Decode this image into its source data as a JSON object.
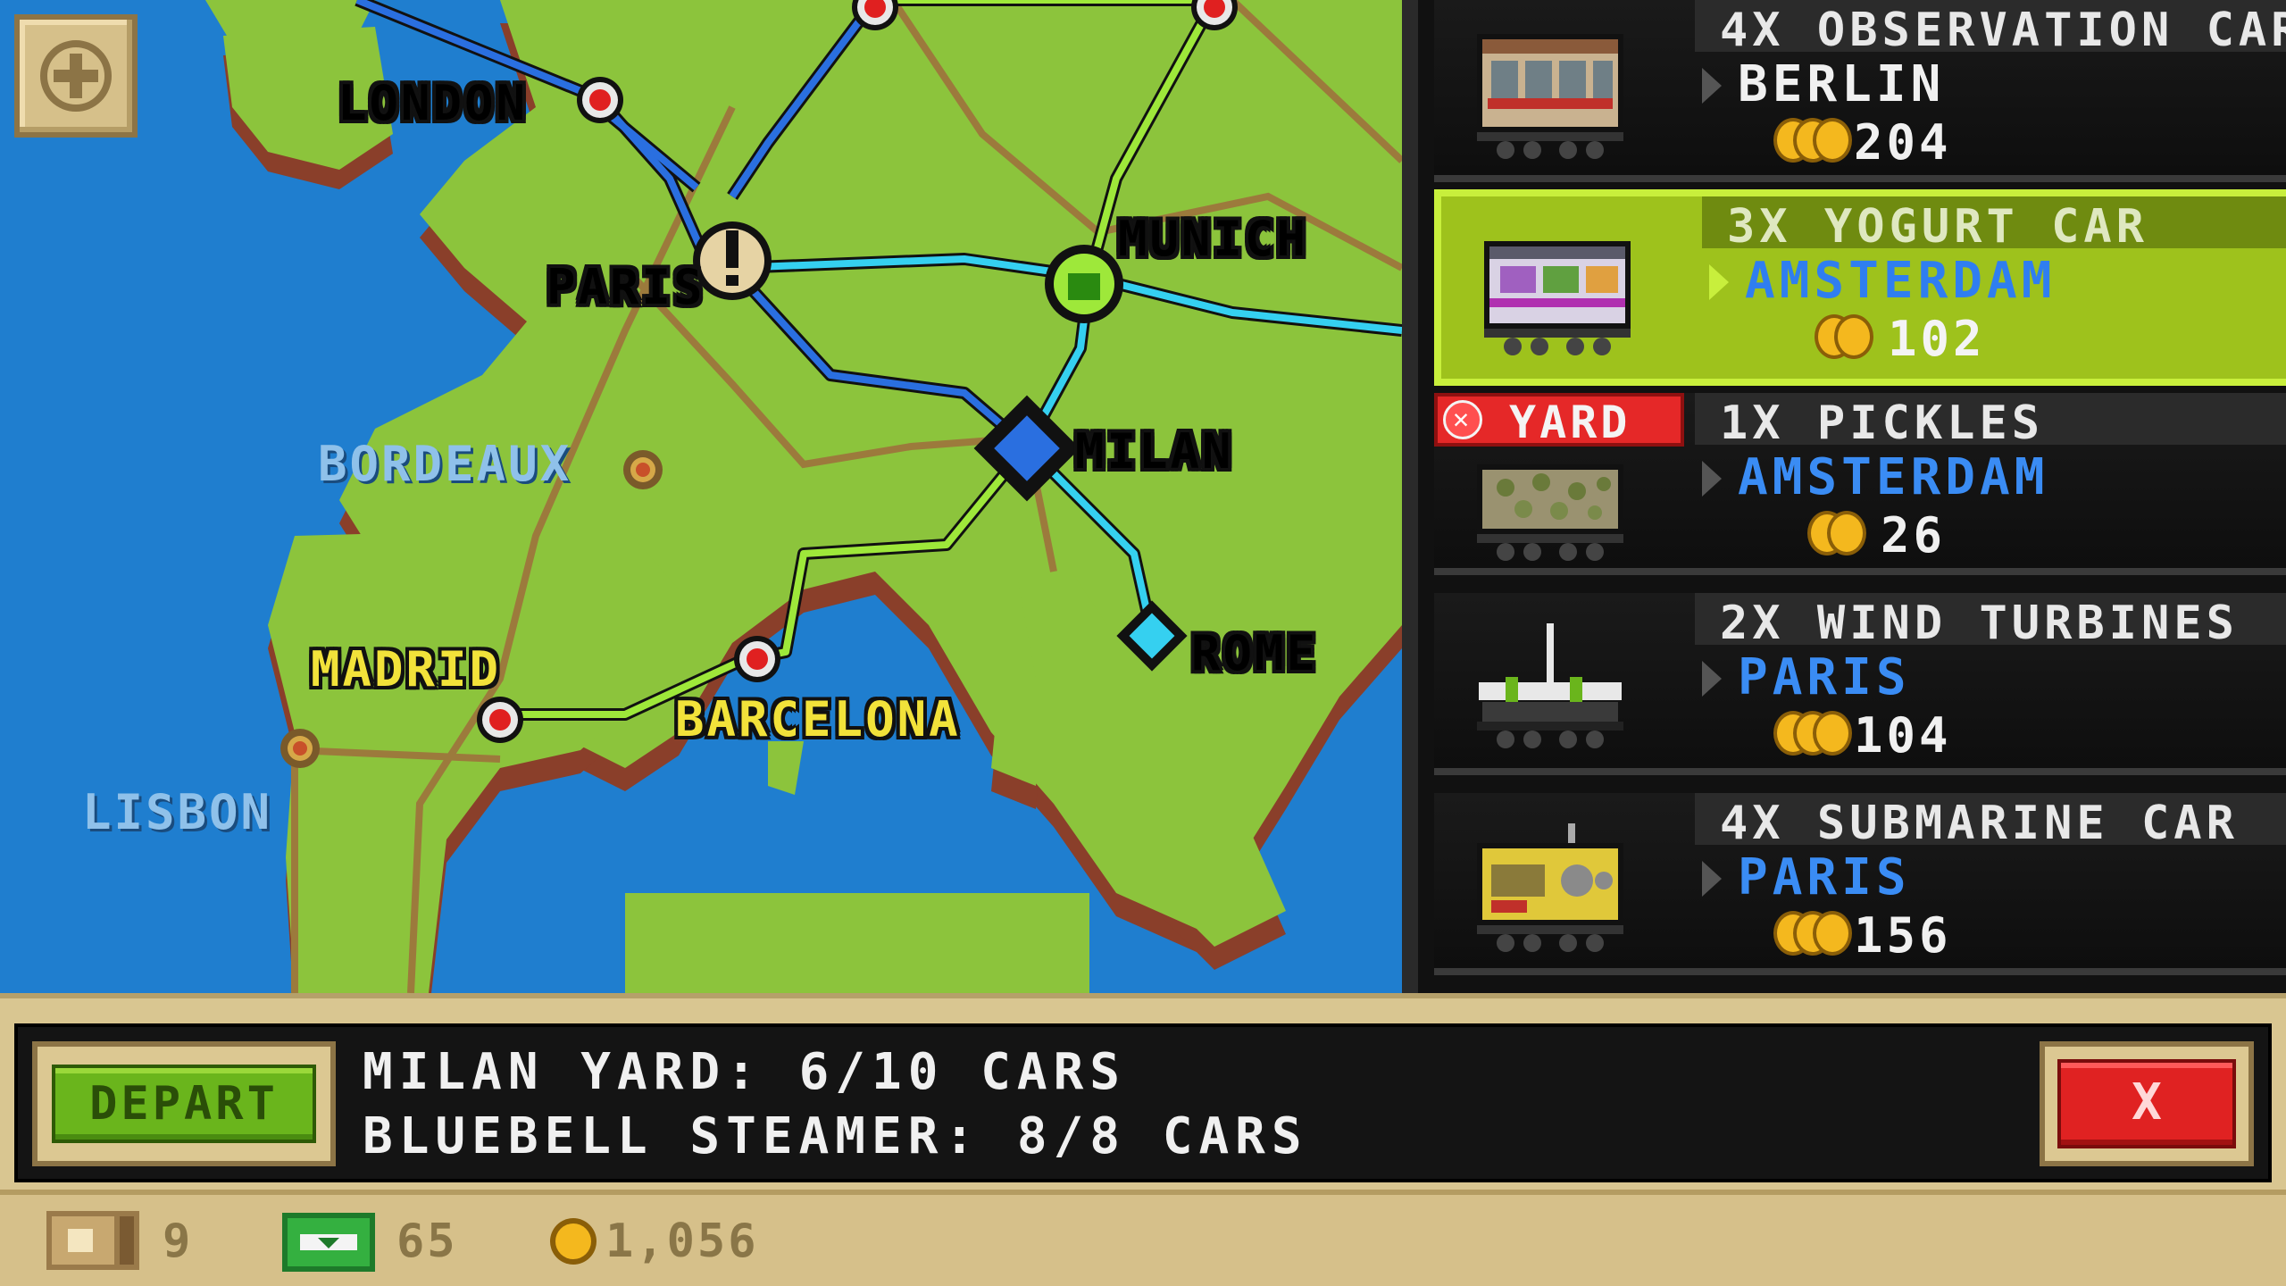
{
  "map": {
    "zoom_icon": "plus-icon",
    "cities": [
      {
        "id": "london",
        "name": "LONDON",
        "color": "#ffffff",
        "dim": false
      },
      {
        "id": "paris",
        "name": "PARIS",
        "color": "#ffffff",
        "dim": false
      },
      {
        "id": "munich",
        "name": "MUNICH",
        "color": "#ffffff",
        "dim": false
      },
      {
        "id": "milan",
        "name": "MILAN",
        "color": "#ffffff",
        "dim": false
      },
      {
        "id": "bordeaux",
        "name": "BORDEAUX",
        "color": "#8fc1ea",
        "dim": true
      },
      {
        "id": "madrid",
        "name": "MADRID",
        "color": "#f2e23a",
        "dim": false
      },
      {
        "id": "barcelona",
        "name": "BARCELONA",
        "color": "#f2e23a",
        "dim": false
      },
      {
        "id": "rome",
        "name": "ROME",
        "color": "#ffffff",
        "dim": false
      },
      {
        "id": "lisbon",
        "name": "LISBON",
        "color": "#8fc1ea",
        "dim": true
      }
    ]
  },
  "cars": [
    {
      "title": "4X OBSERVATION CAR",
      "destination": "BERLIN",
      "dest_color": "#f0f0f0",
      "reward": "204",
      "coins": 3,
      "selected": false,
      "yard": false,
      "icon": "observation-car-icon"
    },
    {
      "title": "3X YOGURT CAR",
      "destination": "AMSTERDAM",
      "dest_color": "#2f7ef0",
      "reward": "102",
      "coins": 2,
      "selected": true,
      "yard": false,
      "icon": "yogurt-car-icon"
    },
    {
      "title": "1X PICKLES",
      "destination": "AMSTERDAM",
      "dest_color": "#3a8cf4",
      "reward": "26",
      "coins": 2,
      "selected": false,
      "yard": true,
      "icon": "pickles-car-icon"
    },
    {
      "title": "2X WIND TURBINES",
      "destination": "PARIS",
      "dest_color": "#3a8cf4",
      "reward": "104",
      "coins": 3,
      "selected": false,
      "yard": false,
      "icon": "wind-turbine-car-icon"
    },
    {
      "title": "4X SUBMARINE CAR",
      "destination": "PARIS",
      "dest_color": "#3a8cf4",
      "reward": "156",
      "coins": 3,
      "selected": false,
      "yard": false,
      "icon": "submarine-car-icon"
    }
  ],
  "yard_tag": {
    "label": "YARD",
    "icon": "close-circle-icon"
  },
  "bottom": {
    "depart_label": "DEPART",
    "yard_status": "MILAN YARD: 6/10 CARS",
    "train_status": "BLUEBELL STEAMER: 8/8 CARS",
    "close_label": "X"
  },
  "stats": {
    "tickets": "9",
    "cash": "65",
    "coins": "1,056"
  },
  "colors": {
    "accent_green": "#9ec21c",
    "ocean": "#1f7ecf",
    "land": "#8cc43c",
    "close_red": "#e02222"
  }
}
